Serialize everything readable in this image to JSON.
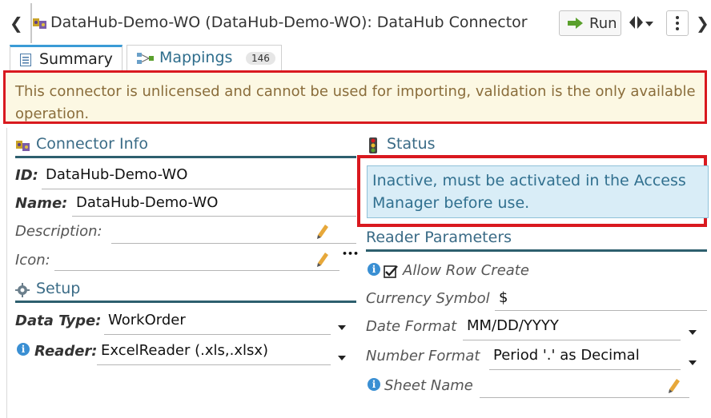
{
  "header": {
    "title": "DataHub-Demo-WO (DataHub-Demo-WO): DataHub Connector",
    "run_label": "Run"
  },
  "tabs": [
    {
      "label": "Summary"
    },
    {
      "label": "Mappings",
      "badge": "146"
    }
  ],
  "warning": "This connector is unlicensed and cannot be used for importing, validation is the only available operation.",
  "connector_info": {
    "heading": "Connector Info",
    "id_label": "ID:",
    "id_value": "DataHub-Demo-WO",
    "name_label": "Name:",
    "name_value": "DataHub-Demo-WO",
    "description_label": "Description:",
    "icon_label": "Icon:",
    "more": "•••"
  },
  "setup": {
    "heading": "Setup",
    "data_type_label": "Data Type:",
    "data_type_value": "WorkOrder",
    "reader_label": "Reader:",
    "reader_value": "ExcelReader (.xls,.xlsx)"
  },
  "status": {
    "heading": "Status",
    "message": "Inactive, must be activated in the Access Manager before use."
  },
  "reader_params": {
    "heading": "Reader Parameters",
    "allow_row_create_label": "Allow Row Create",
    "currency_symbol_label": "Currency Symbol",
    "currency_symbol_value": "$",
    "date_format_label": "Date Format",
    "date_format_value": "MM/DD/YYYY",
    "number_format_label": "Number Format",
    "number_format_value": "Period '.' as Decimal",
    "sheet_name_label": "Sheet Name"
  },
  "colors": {
    "accent": "#3a9bd6",
    "warning_bg": "#fcf8e3",
    "warning_text": "#8a6d3b",
    "highlight_border": "#d9191f",
    "info_bg": "#d9edf7",
    "info_text": "#31708f"
  }
}
